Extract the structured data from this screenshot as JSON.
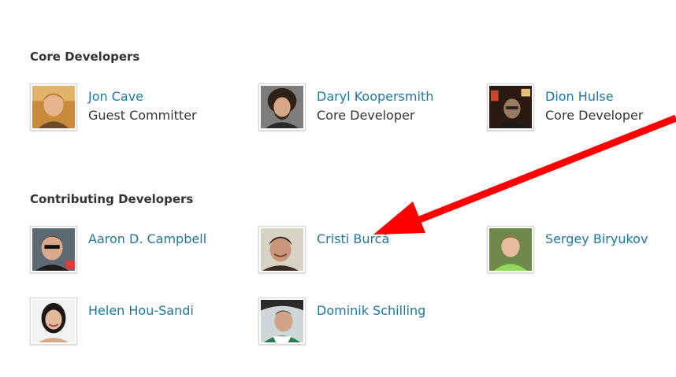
{
  "sections": {
    "core": {
      "heading": "Core Developers",
      "people": [
        {
          "name": "Jon Cave",
          "role": "Guest Committer"
        },
        {
          "name": "Daryl Koopersmith",
          "role": "Core Developer"
        },
        {
          "name": "Dion Hulse",
          "role": "Core Developer"
        }
      ]
    },
    "contributing": {
      "heading": "Contributing Developers",
      "people": [
        {
          "name": "Aaron D. Campbell"
        },
        {
          "name": "Cristi Burcă"
        },
        {
          "name": "Sergey Biryukov"
        },
        {
          "name": "Helen Hou-Sandi"
        },
        {
          "name": "Dominik Schilling"
        }
      ]
    }
  },
  "colors": {
    "link": "#21759b",
    "text": "#333333",
    "annotation_arrow": "#ff0000"
  },
  "annotation": {
    "type": "arrow",
    "points_to": "Cristi Burcă"
  }
}
